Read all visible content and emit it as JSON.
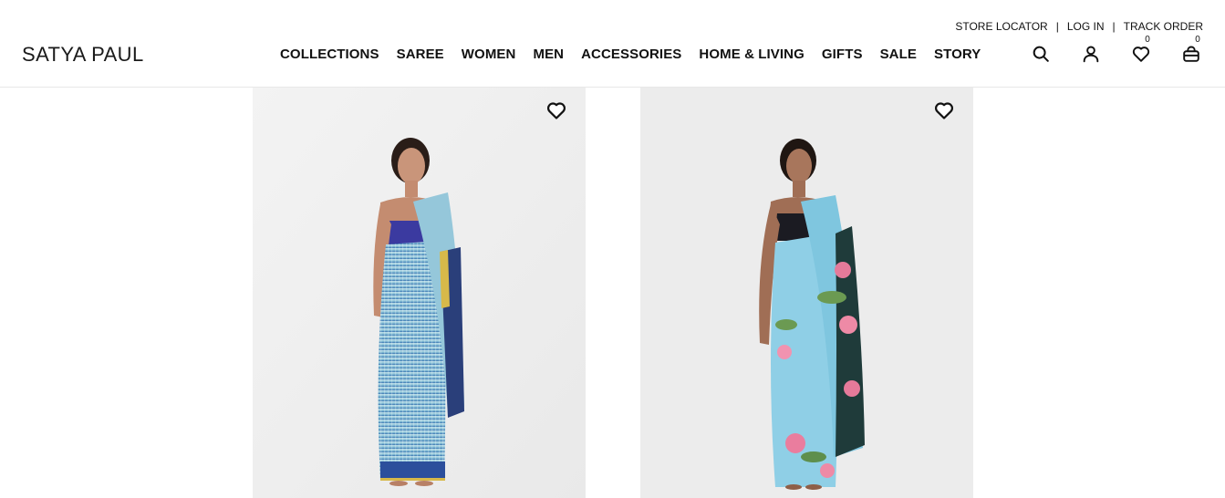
{
  "brand": {
    "logo_text": "SATYA PAUL"
  },
  "utility_nav": {
    "store_locator": "STORE LOCATOR",
    "log_in": "LOG IN",
    "track_order": "TRACK ORDER",
    "separator": "|"
  },
  "main_nav": {
    "items": [
      {
        "label": "COLLECTIONS"
      },
      {
        "label": "SAREE"
      },
      {
        "label": "WOMEN"
      },
      {
        "label": "MEN"
      },
      {
        "label": "ACCESSORIES"
      },
      {
        "label": "HOME & LIVING"
      },
      {
        "label": "GIFTS"
      },
      {
        "label": "SALE"
      },
      {
        "label": "STORY"
      }
    ]
  },
  "header_icons": {
    "search": "search-icon",
    "account": "user-icon",
    "wishlist": "heart-icon",
    "wishlist_count": "0",
    "cart": "bag-icon",
    "cart_count": "0"
  },
  "products": [
    {
      "image": "woman in light blue striped saree with yellow and navy border",
      "wishlist_icon": "heart-icon"
    },
    {
      "image": "woman in sky blue saree with pink lotus floral border",
      "wishlist_icon": "heart-icon"
    }
  ],
  "colors": {
    "text": "#111111",
    "header_border": "#e8e8e8",
    "product_bg_1": "#f1f1f1",
    "product_bg_2": "#ececec"
  }
}
